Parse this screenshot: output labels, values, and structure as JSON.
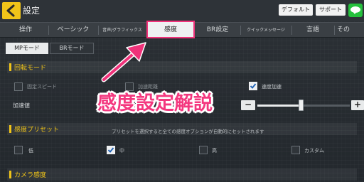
{
  "header": {
    "title": "設定",
    "buttons": {
      "default": "デフォルト",
      "support": "サポート"
    }
  },
  "tabs": [
    {
      "label": "操作"
    },
    {
      "label": "ベーシック"
    },
    {
      "label": "音声/グラフィックス"
    },
    {
      "label": "感度",
      "active": true
    },
    {
      "label": "BR設定"
    },
    {
      "label": "クイックメッセージ"
    },
    {
      "label": "言語"
    },
    {
      "label": "その"
    }
  ],
  "subtabs": [
    {
      "label": "MPモード",
      "active": true
    },
    {
      "label": "BRモード",
      "active": false
    }
  ],
  "rotation": {
    "title": "回転モード",
    "options": [
      {
        "label": "固定スピード",
        "checked": false
      },
      {
        "label": "加速距離",
        "checked": false
      },
      {
        "label": "速度加速",
        "checked": true
      }
    ],
    "accel_label": "加速値",
    "minus": "−",
    "plus": "+",
    "accel_level": 0.47
  },
  "preset": {
    "title": "感度プリセット",
    "hint": "プリセットを選択すると全ての感度オプションが自動的にセットされます",
    "options": [
      {
        "label": "低",
        "checked": false
      },
      {
        "label": "中",
        "checked": true
      },
      {
        "label": "高",
        "checked": false
      },
      {
        "label": "カスタム",
        "checked": false
      }
    ]
  },
  "camera": {
    "title": "カメラ感度"
  },
  "overlay": {
    "caption": "感度設定解説"
  },
  "colors": {
    "accent_pink": "#f0327a",
    "section_yellow": "#f0c419",
    "line_green": "#25c13d"
  },
  "icons": [
    "back-arrow-icon",
    "line-app-icon",
    "checkmark-icon"
  ]
}
